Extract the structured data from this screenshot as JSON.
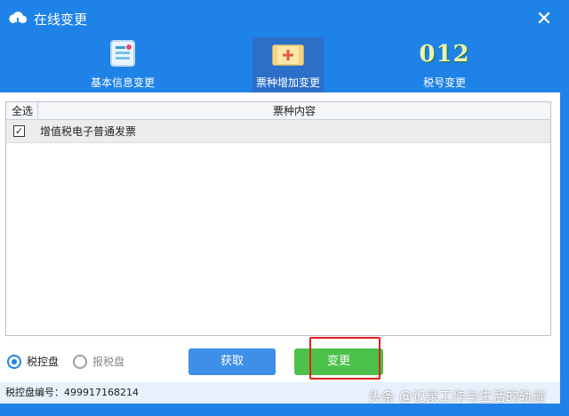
{
  "window": {
    "title": "在线变更"
  },
  "tabs": [
    {
      "label": "基本信息变更",
      "icon": "document-icon"
    },
    {
      "label": "票种增加变更",
      "icon": "ticket-add-icon"
    },
    {
      "label": "税号变更",
      "icon_text": "012"
    }
  ],
  "table": {
    "headers": {
      "select_all": "全选",
      "content": "票种内容"
    },
    "rows": [
      {
        "checked": true,
        "content": "增值税电子普通发票"
      }
    ]
  },
  "options": {
    "radio_tax_control": "税控盘",
    "radio_report": "报税盘"
  },
  "buttons": {
    "fetch": "获取",
    "change": "变更"
  },
  "status": {
    "device_number": "税控盘编号：499917168214"
  },
  "watermark": "头条 @记录工作与生活的轨迹",
  "colors": {
    "window_blue": "#1f82e6",
    "change_green": "#4cc14a",
    "fetch_blue": "#3d8fe8",
    "highlight_red": "#e02020"
  }
}
